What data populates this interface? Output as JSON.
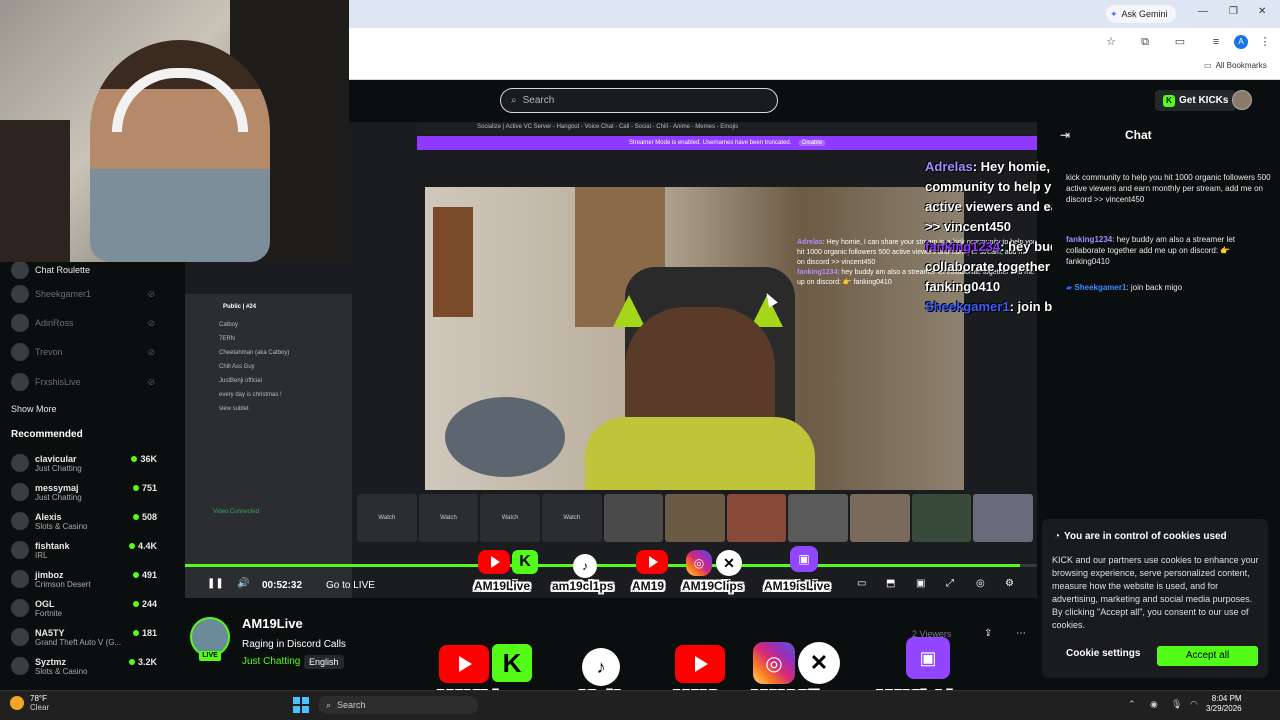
{
  "browser": {
    "ask_gemini": "Ask Gemini",
    "all_bookmarks": "All Bookmarks",
    "profile_initial": "A"
  },
  "header": {
    "search_placeholder": "Search",
    "get_kicks": "Get KICKs"
  },
  "sidebar": {
    "following": [
      {
        "name": "Chat Roulette",
        "live": true
      },
      {
        "name": "Sheekgamer1",
        "live": false
      },
      {
        "name": "AdinRoss",
        "live": false
      },
      {
        "name": "Trevon",
        "live": false
      },
      {
        "name": "FrxshisLive",
        "live": false
      }
    ],
    "show_more": "Show More",
    "recommended_title": "Recommended",
    "recommended": [
      {
        "name": "clavicular",
        "category": "Just Chatting",
        "viewers": "36K"
      },
      {
        "name": "messymaj",
        "category": "Just Chatting",
        "viewers": "751"
      },
      {
        "name": "Alexis",
        "category": "Slots & Casino",
        "viewers": "508"
      },
      {
        "name": "fishtank",
        "category": "IRL",
        "viewers": "4.4K"
      },
      {
        "name": "jimboz",
        "category": "Crimson Desert",
        "viewers": "491"
      },
      {
        "name": "OGL",
        "category": "Fortnite",
        "viewers": "244"
      },
      {
        "name": "NA5TY",
        "category": "Grand Theft Auto V (G...",
        "viewers": "181"
      },
      {
        "name": "Syztmz",
        "category": "Slots & Casino",
        "viewers": "3.2K"
      }
    ]
  },
  "stream": {
    "discord_title": "Socialize | Active VC Server - Hangout - Voice Chat - Call - Social - Chill - Anime - Memes - Emojis",
    "streamer_mode": "Streamer Mode is enabled. Usernames have been truncated.",
    "disable": "Disable",
    "discord_channel": "Public | #24",
    "video_connected": "Video Connected",
    "channels": [
      "Catboy",
      "7ERN",
      "Cheetahman (aka Catboy)",
      "Chill Ass Guy",
      "JustBenji official",
      "every day is christmas !",
      "slew sublet"
    ],
    "watch_label": "Watch",
    "time_code": "00:52:32",
    "go_live": "Go to LIVE",
    "progress": 0.98
  },
  "inner_chat": [
    {
      "user": "Adrelas",
      "text": "Hey homie, I can share your stream in a kick community to help you hit 1000 organic followers 500 active viewers and earn per stream, add me on discord >> vincent450"
    },
    {
      "user": "fanking1234",
      "text": "hey buddy am also a streamer let collaborate together add me up on discord: 👉 fanking0410"
    }
  ],
  "overlay_chat": [
    {
      "user": "Adrelas",
      "text": "Hey homie, I can share your stream in a kick community to help you hit 1000 organic followers 500 active viewers and earn per stream, add me on discord >> vincent450"
    },
    {
      "user": "fanking1234",
      "text": "hey buddy am also a streamer let collaborate together add me up on discord: 👉 fanking0410"
    },
    {
      "user": "Sheekgamer1",
      "text": "join back migo"
    }
  ],
  "chat": {
    "title": "Chat",
    "messages": [
      {
        "user": "",
        "text": "kick community to help you hit 1000 organic followers 500 active viewers and earn monthly per stream, add me on discord >> vincent450"
      },
      {
        "user": "fanking1234",
        "text": "hey buddy am also a streamer let collaborate together add me up on discord: 👉 fanking0410"
      },
      {
        "user": "Sheekgamer1",
        "text": "join back migo"
      }
    ]
  },
  "cookie": {
    "title": "You are in control of cookies used",
    "text": "KICK and our partners use cookies to enhance your browsing experience, serve personalized content, measure how the website is used, and for advertising, marketing and social media purposes. By clicking \"Accept all\", you consent to our use of cookies.",
    "settings": "Cookie settings",
    "accept": "Accept all"
  },
  "streamer": {
    "name": "AM19Live",
    "title": "Raging in Discord Calls",
    "category": "Just Chatting",
    "language": "English",
    "viewers": "2 Viewers",
    "live": "LIVE"
  },
  "socials": {
    "yt_kick_label": "AM19Live",
    "tiktok_label": "am19cl1ps",
    "yt2_label": "AM19",
    "ig_x_label": "AM19Clips",
    "twitch_label": "AM19isLive",
    "k_letter": "K"
  },
  "taskbar": {
    "temp": "78°F",
    "condition": "Clear",
    "search": "Search",
    "time": "8:04 PM",
    "date": "3/29/2026"
  }
}
